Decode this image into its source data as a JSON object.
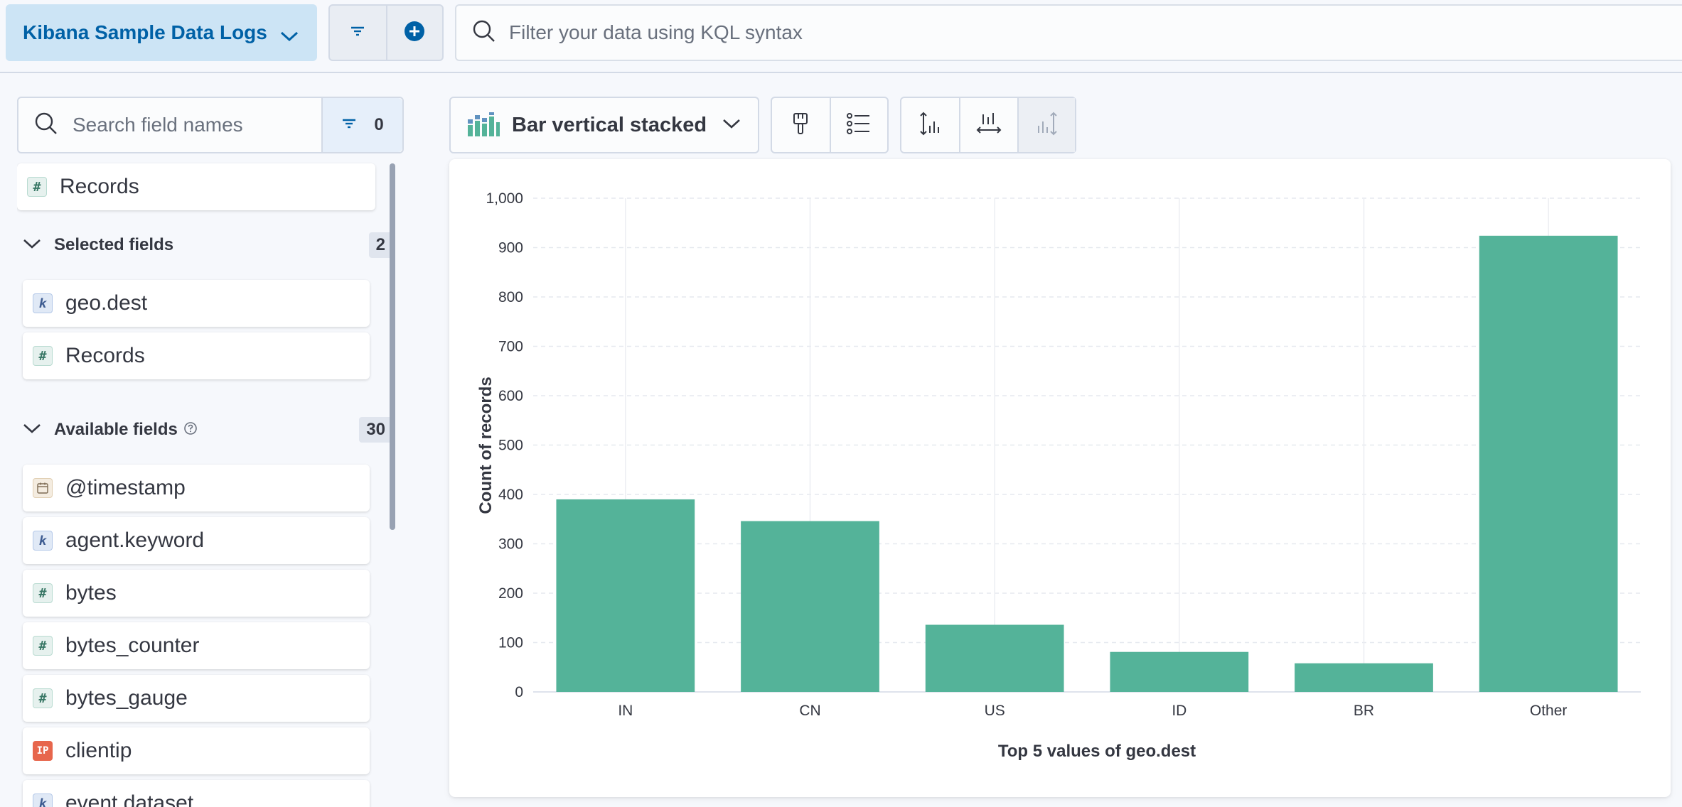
{
  "topbar": {
    "dataview_label": "Kibana Sample Data Logs",
    "kql_placeholder": "Filter your data using KQL syntax"
  },
  "sidebar": {
    "search_placeholder": "Search field names",
    "filter_count": "0",
    "records_label": "Records",
    "selected_section": {
      "title": "Selected fields",
      "count": "2",
      "items": [
        {
          "name": "geo.dest",
          "type": "k"
        },
        {
          "name": "Records",
          "type": "#"
        }
      ]
    },
    "available_section": {
      "title": "Available fields",
      "count": "30",
      "items": [
        {
          "name": "@timestamp",
          "type": "date"
        },
        {
          "name": "agent.keyword",
          "type": "k"
        },
        {
          "name": "bytes",
          "type": "#"
        },
        {
          "name": "bytes_counter",
          "type": "#"
        },
        {
          "name": "bytes_gauge",
          "type": "#"
        },
        {
          "name": "clientip",
          "type": "ip"
        },
        {
          "name": "event.dataset",
          "type": "k"
        }
      ]
    }
  },
  "toolbar": {
    "chart_type_label": "Bar vertical stacked",
    "icons": [
      "paintbrush-icon",
      "legend-icon",
      "left-axis-icon",
      "bottom-axis-icon",
      "right-axis-icon"
    ]
  },
  "colors": {
    "bar": "#54b399",
    "accent": "#0061a6"
  },
  "chart_data": {
    "type": "bar",
    "categories": [
      "IN",
      "CN",
      "US",
      "ID",
      "BR",
      "Other"
    ],
    "series": [
      {
        "values": [
          390,
          346,
          136,
          81,
          58,
          924
        ]
      }
    ],
    "xlabel": "Top 5 values of geo.dest",
    "ylabel": "Count of records",
    "ylim": [
      0,
      1000
    ],
    "yticks": [
      "0",
      "100",
      "200",
      "300",
      "400",
      "500",
      "600",
      "700",
      "800",
      "900",
      "1,000"
    ],
    "grid": true,
    "legend": "none"
  }
}
